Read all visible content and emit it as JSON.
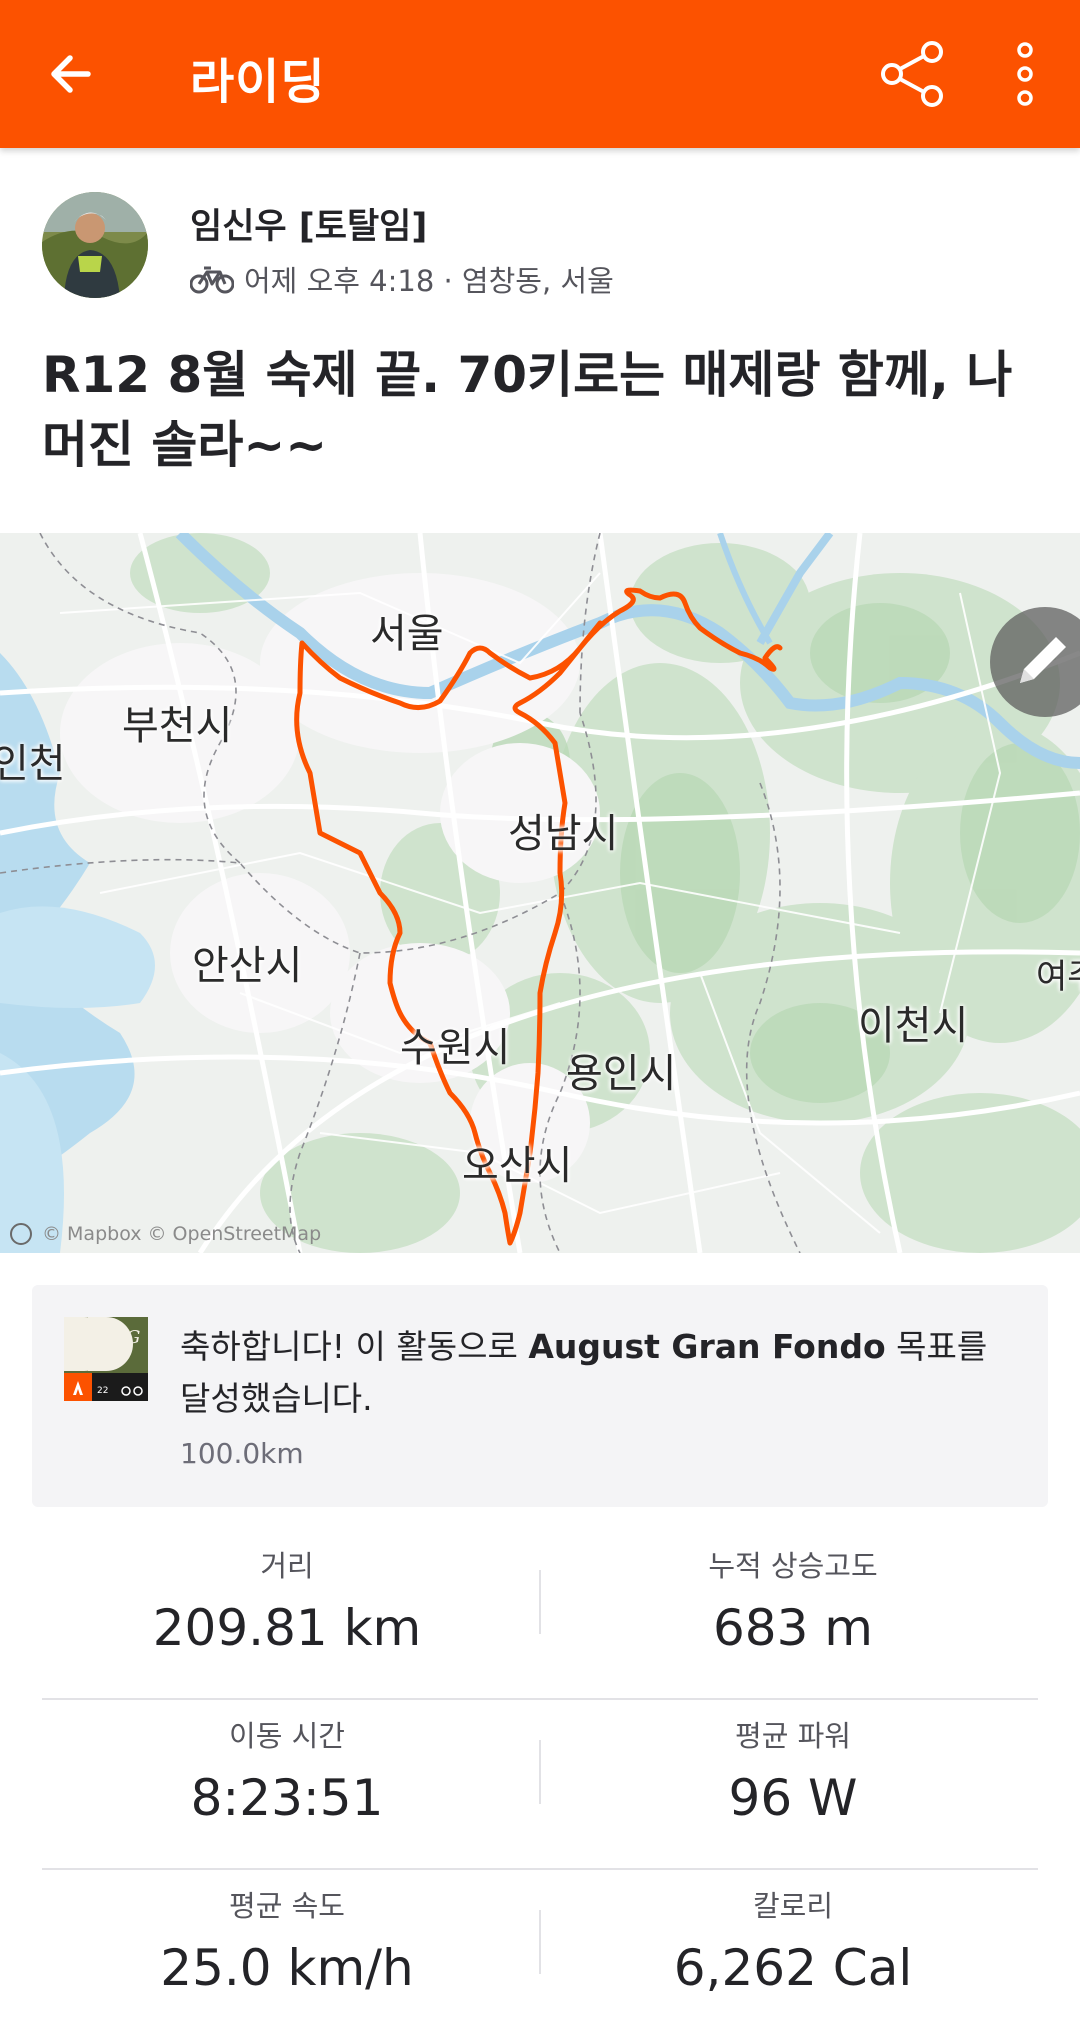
{
  "header": {
    "title": "라이딩",
    "back_icon": "arrow-left-icon",
    "share_icon": "share-icon",
    "more_icon": "more-vertical-icon",
    "bg_color": "#fc5200"
  },
  "athlete": {
    "name": "임신우 [토탈임]",
    "activity_icon": "bike-icon",
    "time_location": "어제 오후 4:18 · 염창동, 서울"
  },
  "activity": {
    "title": "R12 8월 숙제 끝. 70키로는 매제랑 함께, 나머진 솔라~~"
  },
  "map": {
    "labels": {
      "seoul": "서울",
      "bucheon": "부천시",
      "incheon": "인천",
      "seongnam": "성남시",
      "ansan": "안산시",
      "suwon": "수원시",
      "yongin": "용인시",
      "icheon": "이천시",
      "osan": "오산시",
      "yeoju": "여주"
    },
    "attribution": "© Mapbox © OpenStreetMap",
    "edit_icon": "pencil-icon",
    "route_color": "#fc5200"
  },
  "achievement": {
    "text_prefix": "축하합니다! 이 활동으로 ",
    "challenge_name": "August Gran Fondo",
    "text_suffix": " 목표를 달성했습니다.",
    "detail": "100.0km",
    "badge_icon": "gran-fondo-badge-icon"
  },
  "stats": [
    {
      "left": {
        "label": "거리",
        "value": "209.81 km"
      },
      "right": {
        "label": "누적 상승고도",
        "value": "683 m"
      }
    },
    {
      "left": {
        "label": "이동 시간",
        "value": "8:23:51"
      },
      "right": {
        "label": "평균 파워",
        "value": "96 W"
      }
    },
    {
      "left": {
        "label": "평균 속도",
        "value": "25.0 km/h"
      },
      "right": {
        "label": "칼로리",
        "value": "6,262 Cal"
      }
    }
  ]
}
